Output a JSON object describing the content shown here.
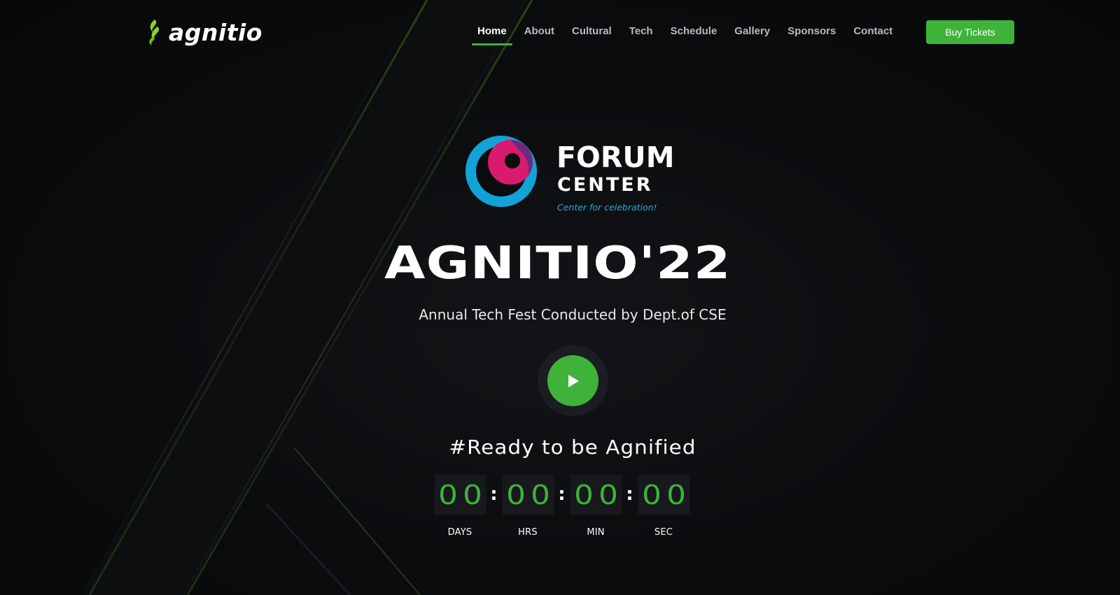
{
  "brand": {
    "name": "agnitio",
    "icon": "flame-leaf-icon",
    "accent_color": "#8ccf2e"
  },
  "nav": {
    "items": [
      {
        "label": "Home",
        "active": true
      },
      {
        "label": "About",
        "active": false
      },
      {
        "label": "Cultural",
        "active": false
      },
      {
        "label": "Tech",
        "active": false
      },
      {
        "label": "Schedule",
        "active": false
      },
      {
        "label": "Gallery",
        "active": false
      },
      {
        "label": "Sponsors",
        "active": false
      },
      {
        "label": "Contact",
        "active": false
      }
    ],
    "cta_label": "Buy Tickets"
  },
  "sponsor": {
    "line1": "FORUM",
    "line2": "CENTER",
    "tagline": "Center for celebration!"
  },
  "hero": {
    "title": "AGNITIO'22",
    "subtitle": "Annual Tech Fest Conducted by Dept.of CSE",
    "play_icon": "play-icon",
    "ready_text": "#Ready to be Agnified"
  },
  "countdown": {
    "units": [
      {
        "digits": [
          "0",
          "0"
        ],
        "label": "DAYS"
      },
      {
        "digits": [
          "0",
          "0"
        ],
        "label": "HRS"
      },
      {
        "digits": [
          "0",
          "0"
        ],
        "label": "MIN"
      },
      {
        "digits": [
          "0",
          "0"
        ],
        "label": "SEC"
      }
    ],
    "separator": ":"
  },
  "colors": {
    "accent_green": "#3fb23a",
    "background": "#0a0b0d",
    "logo_blue": "#12a3d6",
    "logo_pink": "#d81b6e",
    "logo_purple": "#6a2a80"
  }
}
